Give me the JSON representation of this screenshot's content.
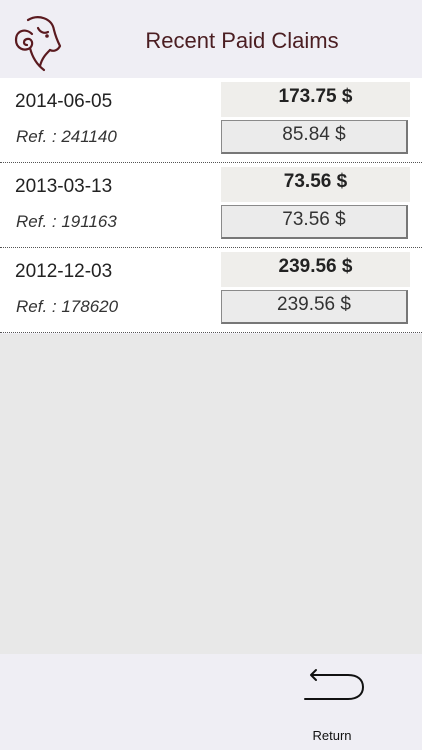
{
  "header": {
    "title": "Recent Paid Claims",
    "logo_icon": "ram-head-icon",
    "title_color": "#4b1e22"
  },
  "claims": [
    {
      "date": "2014-06-05",
      "ref": "Ref. : 241140",
      "total": "173.75 $",
      "paid": "85.84 $"
    },
    {
      "date": "2013-03-13",
      "ref": "Ref. : 191163",
      "total": "73.56 $",
      "paid": "73.56 $"
    },
    {
      "date": "2012-12-03",
      "ref": "Ref. : 178620",
      "total": "239.56 $",
      "paid": "239.56 $"
    }
  ],
  "footer": {
    "return_label": "Return",
    "return_icon": "return-arrow-icon"
  }
}
